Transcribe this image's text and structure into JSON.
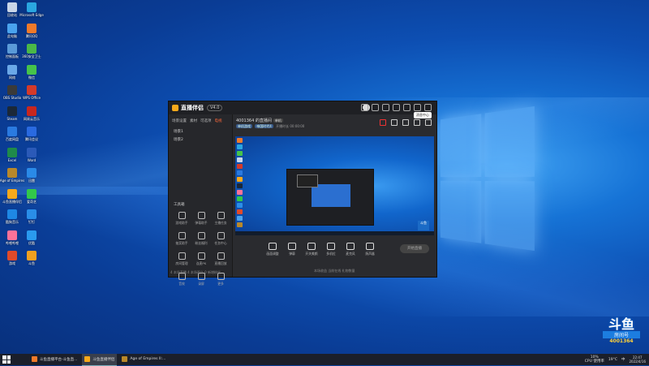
{
  "desktop": {
    "icons": [
      {
        "label": "回收站",
        "color": "#c9d6e8"
      },
      {
        "label": "Microsoft Edge",
        "color": "#2aa6e0"
      },
      {
        "label": "此电脑",
        "color": "#4aa3ee"
      },
      {
        "label": "腾讯QQ",
        "color": "#f07a2a"
      },
      {
        "label": "控制面板",
        "color": "#5a9ad8"
      },
      {
        "label": "360安全卫士",
        "color": "#4ab848"
      },
      {
        "label": "网络",
        "color": "#6aa8e8"
      },
      {
        "label": "微信",
        "color": "#46c34a"
      },
      {
        "label": "OBS Studio",
        "color": "#3a3a3a"
      },
      {
        "label": "WPS Office",
        "color": "#d43a2a"
      },
      {
        "label": "Steam",
        "color": "#1b2838"
      },
      {
        "label": "网易云音乐",
        "color": "#c8271f"
      },
      {
        "label": "百度网盘",
        "color": "#2a7ae0"
      },
      {
        "label": "腾讯会议",
        "color": "#2a6ae0"
      },
      {
        "label": "Excel",
        "color": "#1f8a4a"
      },
      {
        "label": "Word",
        "color": "#2b5ab8"
      },
      {
        "label": "Age of Empires",
        "color": "#b8882a"
      },
      {
        "label": "迅雷",
        "color": "#2a8ae8"
      },
      {
        "label": "斗鱼直播伴侣",
        "color": "#f7a91b"
      },
      {
        "label": "爱奇艺",
        "color": "#32c84a"
      },
      {
        "label": "酷狗音乐",
        "color": "#1e88e5"
      },
      {
        "label": "钉钉",
        "color": "#2a8ee8"
      },
      {
        "label": "哔哩哔哩",
        "color": "#fb7299"
      },
      {
        "label": "优酷",
        "color": "#2a9aee"
      },
      {
        "label": "游戏",
        "color": "#e04a2a"
      },
      {
        "label": "斗鱼",
        "color": "#f0a020"
      }
    ]
  },
  "app": {
    "title": "直播伴侣",
    "version": "V4.0",
    "left_tabs": [
      "场景设置",
      "素材",
      "可选项",
      "电视"
    ],
    "scenes": [
      "场景1",
      "场景2"
    ],
    "tools_header": "工具箱",
    "tools": [
      "游戏助手",
      "弹幕助手",
      "主播任务",
      "抽奖助手",
      "粉丝福利",
      "任务中心",
      "房间管理",
      "连麦PK",
      "直播回放",
      "音效",
      "录屏",
      "更多"
    ],
    "left_footer": "4 本场直播  4 本场观众  0 新增粉丝",
    "room_title": "4001364 的直播间",
    "room_tag": "单机",
    "sub_line": [
      "单机游戏",
      "帝国时代4",
      "开播时长 00:00:00"
    ],
    "controls": [
      "画面调整",
      "弹幕",
      "开关美颜",
      "多机位",
      "麦克风",
      "扬声器"
    ],
    "go_live": "开始直播",
    "main_footer": "本场收益    当前在线    礼物数量"
  },
  "tooltip": "消息中心",
  "watermark": {
    "brand": "斗鱼",
    "room_label": "房间号",
    "room_no": "4001364"
  },
  "taskbar": {
    "items": [
      {
        "label": "斗鱼直播平台-斗鱼直...",
        "color": "#f07a2a",
        "active": false
      },
      {
        "label": "斗鱼直播伴侣",
        "color": "#f7a91b",
        "active": true
      },
      {
        "label": "Age of Empires II:...",
        "color": "#b8882a",
        "active": false
      }
    ],
    "cpu": "CPU 使用率",
    "cpu_value": "10%",
    "weather": "19°C",
    "ime": "中",
    "time": "22:47",
    "date": "2022/4/16"
  }
}
